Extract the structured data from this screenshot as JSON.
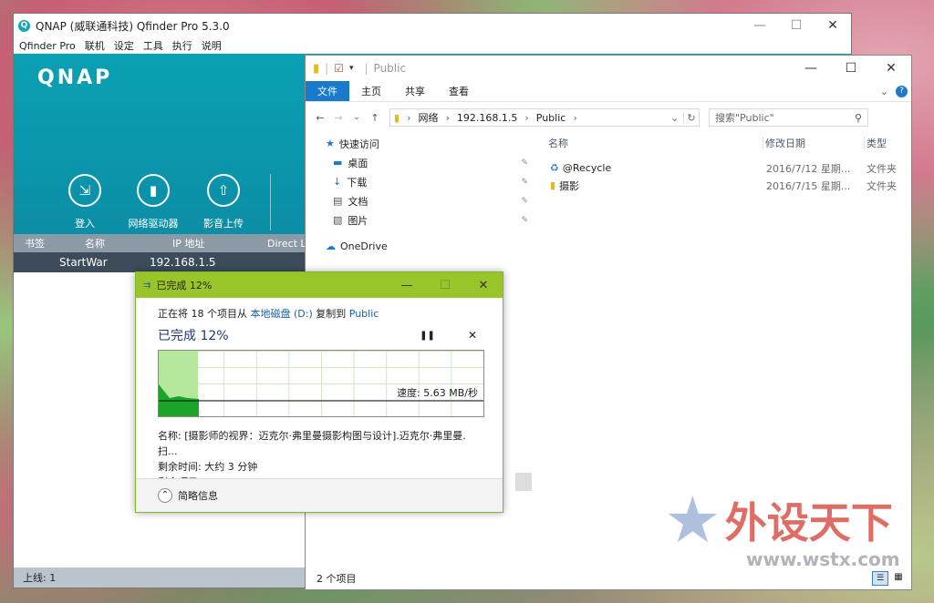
{
  "qfinder": {
    "title": "QNAP (威联通科技) Qfinder Pro 5.3.0",
    "menu": [
      "Qfinder Pro",
      "联机",
      "设定",
      "工具",
      "执行",
      "说明"
    ],
    "brand": "QNAP",
    "tools": [
      "登入",
      "网络驱动器",
      "影音上传"
    ],
    "columns": [
      "书签",
      "名称",
      "IP 地址",
      "Direct Link IP"
    ],
    "row": {
      "name": "StartWar",
      "ip": "192.168.1.5"
    },
    "status": "上线: 1"
  },
  "explorer": {
    "title": "Public",
    "ribbon_tabs": [
      "文件",
      "主页",
      "共享",
      "查看"
    ],
    "breadcrumb": [
      "网络",
      "192.168.1.5",
      "Public"
    ],
    "search_placeholder": "搜索\"Public\"",
    "nav": {
      "quick_access": "快速访问",
      "items": [
        "桌面",
        "下载",
        "文档",
        "图片"
      ],
      "onedrive": "OneDrive"
    },
    "columns": [
      "名称",
      "修改日期",
      "类型"
    ],
    "files": [
      {
        "name": "@Recycle",
        "date": "2016/7/12 星期...",
        "type": "文件夹"
      },
      {
        "name": "摄影",
        "date": "2016/7/15 星期...",
        "type": "文件夹"
      }
    ],
    "status": "2 个项目"
  },
  "copy_dialog": {
    "title": "已完成 12%",
    "line1_prefix": "正在将 18 个项目从",
    "source": "本地磁盘 (D:)",
    "line1_mid": "复制到",
    "dest": "Public",
    "progress_title": "已完成 12%",
    "progress_percent": 12,
    "speed": "速度: 5.63 MB/秒",
    "name_line": "名称: [摄影师的视界：迈克尔·弗里曼摄影构图与设计].迈克尔·弗里曼.扫...",
    "time_left": "剩余时间: 大约 3 分钟",
    "items_left": "剩余项目: 15 (1.08 GB)",
    "less_details": "简略信息"
  },
  "watermark": {
    "text": "外设天下",
    "url": "www.wstx.com"
  }
}
